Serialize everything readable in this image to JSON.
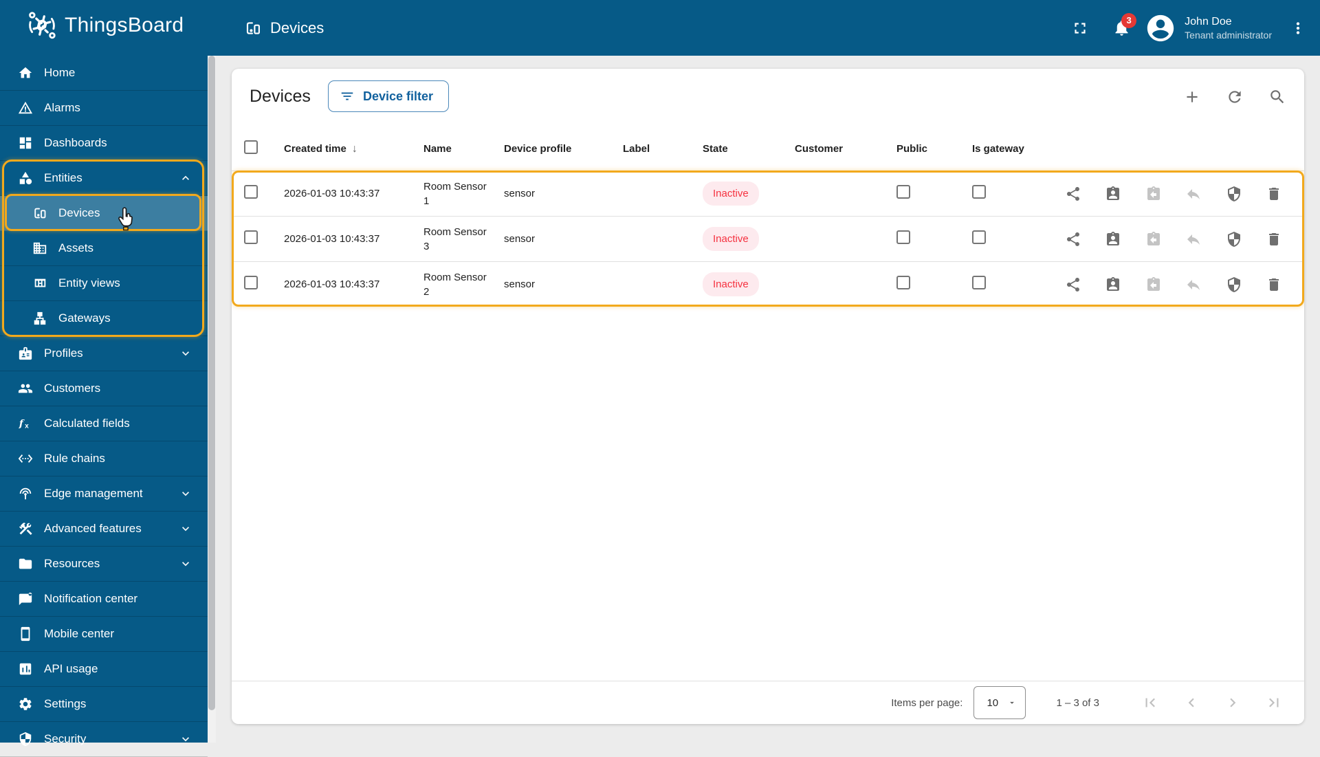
{
  "brand": {
    "name": "ThingsBoard"
  },
  "topbar": {
    "breadcrumb": "Devices",
    "notification_count": "3",
    "user_name": "John Doe",
    "user_role": "Tenant administrator"
  },
  "sidebar": {
    "items": [
      {
        "label": "Home",
        "icon": "home"
      },
      {
        "label": "Alarms",
        "icon": "alarms"
      },
      {
        "label": "Dashboards",
        "icon": "dashboards"
      },
      {
        "label": "Entities",
        "icon": "entities",
        "expandable": true,
        "expanded": true,
        "children": [
          {
            "label": "Devices",
            "icon": "devices",
            "selected": true
          },
          {
            "label": "Assets",
            "icon": "assets"
          },
          {
            "label": "Entity views",
            "icon": "entity-views"
          },
          {
            "label": "Gateways",
            "icon": "gateways"
          }
        ]
      },
      {
        "label": "Profiles",
        "icon": "profiles",
        "expandable": true
      },
      {
        "label": "Customers",
        "icon": "customers"
      },
      {
        "label": "Calculated fields",
        "icon": "calculated-fields"
      },
      {
        "label": "Rule chains",
        "icon": "rule-chains"
      },
      {
        "label": "Edge management",
        "icon": "edge-management",
        "expandable": true
      },
      {
        "label": "Advanced features",
        "icon": "advanced-features",
        "expandable": true
      },
      {
        "label": "Resources",
        "icon": "resources",
        "expandable": true
      },
      {
        "label": "Notification center",
        "icon": "notification-center"
      },
      {
        "label": "Mobile center",
        "icon": "mobile-center"
      },
      {
        "label": "API usage",
        "icon": "api-usage"
      },
      {
        "label": "Settings",
        "icon": "settings"
      },
      {
        "label": "Security",
        "icon": "security",
        "expandable": true
      }
    ]
  },
  "page": {
    "title": "Devices",
    "filter_button": "Device filter"
  },
  "table": {
    "columns": [
      "Created time",
      "Name",
      "Device profile",
      "Label",
      "State",
      "Customer",
      "Public",
      "Is gateway"
    ],
    "sorted_column": "Created time",
    "sort_direction": "desc",
    "rows": [
      {
        "created_time": "2026-01-03 10:43:37",
        "name": "Room Sensor 1",
        "device_profile": "sensor",
        "label": "",
        "state": "Inactive",
        "customer": "",
        "public": false,
        "is_gateway": false
      },
      {
        "created_time": "2026-01-03 10:43:37",
        "name": "Room Sensor 3",
        "device_profile": "sensor",
        "label": "",
        "state": "Inactive",
        "customer": "",
        "public": false,
        "is_gateway": false
      },
      {
        "created_time": "2026-01-03 10:43:37",
        "name": "Room Sensor 2",
        "device_profile": "sensor",
        "label": "",
        "state": "Inactive",
        "customer": "",
        "public": false,
        "is_gateway": false
      }
    ],
    "row_actions": [
      {
        "name": "share",
        "icon": "share",
        "disabled": false
      },
      {
        "name": "assign-to-customer",
        "icon": "assignment-ind",
        "disabled": false
      },
      {
        "name": "unassign-from-customer",
        "icon": "assignment-return",
        "disabled": true
      },
      {
        "name": "make-private",
        "icon": "reply",
        "disabled": true
      },
      {
        "name": "manage-credentials",
        "icon": "security",
        "disabled": false
      },
      {
        "name": "delete",
        "icon": "delete",
        "disabled": false
      }
    ]
  },
  "pagination": {
    "items_per_page_label": "Items per page:",
    "items_per_page": "10",
    "range": "1 – 3 of 3"
  },
  "colors": {
    "primary": "#065a87",
    "highlight_gold": "#f2a91c",
    "accent_blue": "#11619e",
    "inactive_text": "#f5313f",
    "inactive_bg": "#fdeaee",
    "badge_red": "#e53935",
    "page_bg": "#ececec"
  }
}
